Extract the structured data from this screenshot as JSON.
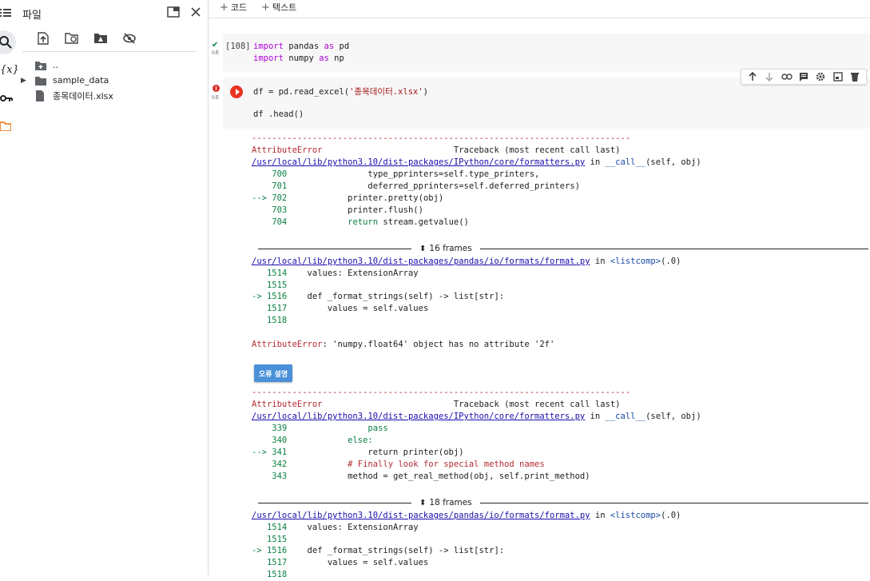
{
  "sidebar": {
    "title": "파일",
    "tree": [
      {
        "label": ".."
      },
      {
        "label": "sample_data"
      },
      {
        "label": "종목데이터.xlsx"
      }
    ]
  },
  "rail_icons": [
    "menu-icon",
    "search-icon",
    "variables-icon",
    "key-icon",
    "folder-icon"
  ],
  "topbar": {
    "add_code": "코드",
    "add_text": "텍스트"
  },
  "cell1": {
    "exec_count": "[108]",
    "status_sub": "0초",
    "lines": [
      {
        "kw": "import",
        "rest": " pandas ",
        "kw2": "as",
        "rest2": " pd"
      },
      {
        "kw": "import",
        "rest": " numpy ",
        "kw2": "as",
        "rest2": " np"
      }
    ]
  },
  "cell2": {
    "status_sub": "0초",
    "line1_a": "df = pd.read_excel(",
    "line1_str": "'종목데이터.xlsx'",
    "line1_b": ")",
    "line2": "df .head()"
  },
  "output": {
    "dashes": "---------------------------------------------------------------------------",
    "tb1": {
      "error_name": "AttributeError",
      "traceback_label": "Traceback (most recent call last)",
      "file": "/usr/local/lib/python3.10/dist-packages/IPython/core/formatters.py",
      "in_word": " in ",
      "func": "__call__",
      "args": "(self, obj)",
      "lines": [
        {
          "num": "    700",
          "code": "                type_pprinters=self.type_printers,"
        },
        {
          "num": "    701",
          "code": "                deferred_pprinters=self.deferred_printers)"
        },
        {
          "num": "--> 702",
          "code": "            printer.pretty(obj)"
        },
        {
          "num": "    703",
          "code": "            printer.flush()"
        },
        {
          "num": "    704",
          "code": "            return stream.getvalue()"
        }
      ],
      "frames": "16 frames",
      "file2": "/usr/local/lib/python3.10/dist-packages/pandas/io/formats/format.py",
      "func2": "<listcomp>",
      "args2": "(.0)",
      "lines2": [
        {
          "num": "   1514",
          "code": "    values: ExtensionArray"
        },
        {
          "num": "   1515",
          "code": ""
        },
        {
          "num": "-> 1516",
          "code": "    def _format_strings(self) -> list[str]:"
        },
        {
          "num": "   1517",
          "code": "        values = self.values"
        },
        {
          "num": "   1518",
          "code": ""
        }
      ],
      "final_error": "AttributeError",
      "final_msg": ": 'numpy.float64' object has no attribute '2f'"
    },
    "explain_button": "오류 설명",
    "tb2": {
      "error_name": "AttributeError",
      "traceback_label": "Traceback (most recent call last)",
      "file": "/usr/local/lib/python3.10/dist-packages/IPython/core/formatters.py",
      "in_word": " in ",
      "func": "__call__",
      "args": "(self, obj)",
      "lines": [
        {
          "num": "    339",
          "code": "                pass"
        },
        {
          "num": "    340",
          "code": "            else:"
        },
        {
          "num": "--> 341",
          "code": "                return printer(obj)"
        },
        {
          "num": "    342",
          "code": "            # Finally look for special method names"
        },
        {
          "num": "    343",
          "code": "            method = get_real_method(obj, self.print_method)"
        }
      ],
      "frames": "18 frames",
      "file2": "/usr/local/lib/python3.10/dist-packages/pandas/io/formats/format.py",
      "func2": "<listcomp>",
      "args2": "(.0)",
      "lines2": [
        {
          "num": "   1514",
          "code": "    values: ExtensionArray"
        },
        {
          "num": "   1515",
          "code": ""
        },
        {
          "num": "-> 1516",
          "code": "    def _format_strings(self) -> list[str]:"
        },
        {
          "num": "   1517",
          "code": "        values = self.values"
        },
        {
          "num": "   1518",
          "code": ""
        }
      ]
    }
  }
}
